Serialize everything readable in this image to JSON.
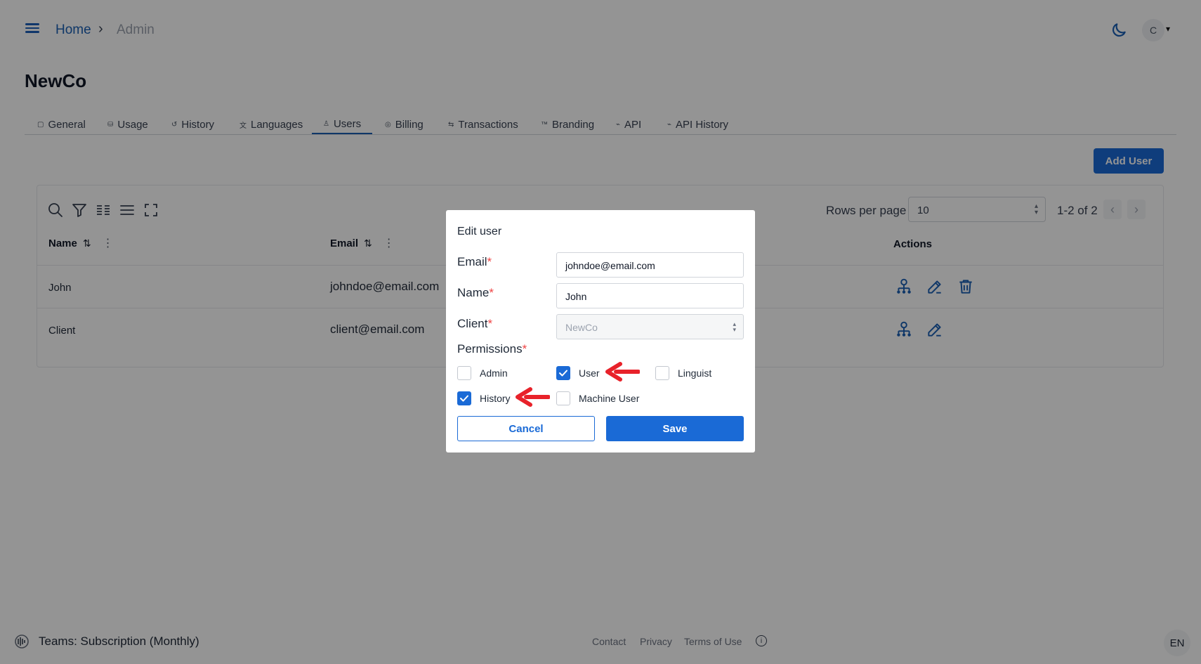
{
  "breadcrumb": {
    "home": "Home",
    "separator": "›",
    "current": "Admin"
  },
  "header": {
    "avatar_initial": "C"
  },
  "page": {
    "title": "NewCo"
  },
  "tabs": [
    {
      "label": "General",
      "icon": "general-icon"
    },
    {
      "label": "Usage",
      "icon": "usage-icon"
    },
    {
      "label": "History",
      "icon": "history-icon"
    },
    {
      "label": "Languages",
      "icon": "languages-icon"
    },
    {
      "label": "Users",
      "icon": "user-icon",
      "active": true
    },
    {
      "label": "Billing",
      "icon": "billing-icon"
    },
    {
      "label": "Transactions",
      "icon": "transactions-icon"
    },
    {
      "label": "Branding",
      "icon": "branding-icon"
    },
    {
      "label": "API",
      "icon": "api-icon"
    },
    {
      "label": "API History",
      "icon": "api-history-icon"
    }
  ],
  "actions": {
    "add_user": "Add User"
  },
  "table": {
    "rows_per_page_label": "Rows per page",
    "rows_per_page_value": "10",
    "range_text": "1-2 of 2",
    "columns": {
      "name": "Name",
      "email": "Email",
      "actions": "Actions"
    },
    "rows": [
      {
        "name": "John",
        "email": "johndoe@email.com"
      },
      {
        "name": "Client",
        "email": "client@email.com"
      }
    ]
  },
  "modal": {
    "title": "Edit user",
    "email_label": "Email",
    "email_value": "johndoe@email.com",
    "name_label": "Name",
    "name_value": "John",
    "client_label": "Client",
    "client_value": "NewCo",
    "permissions_label": "Permissions",
    "required_mark": "*",
    "permissions": [
      {
        "label": "Admin",
        "checked": false
      },
      {
        "label": "User",
        "checked": true
      },
      {
        "label": "Linguist",
        "checked": false
      },
      {
        "label": "History",
        "checked": true
      },
      {
        "label": "Machine User",
        "checked": false
      }
    ],
    "cancel_label": "Cancel",
    "save_label": "Save"
  },
  "footer": {
    "plan": "Teams: Subscription (Monthly)",
    "links": [
      "Contact",
      "Privacy",
      "Terms of Use"
    ],
    "language": "EN"
  },
  "colors": {
    "primary": "#1a6ad6",
    "link": "#1a5fb4",
    "annotation_arrow": "#e8222a",
    "required": "#ef4444"
  }
}
